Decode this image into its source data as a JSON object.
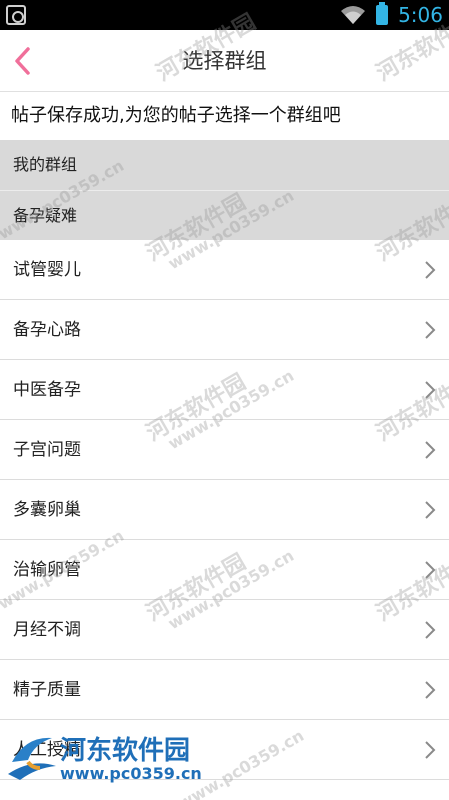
{
  "status_bar": {
    "time": "5:06",
    "icons": [
      "screenshot-icon",
      "wifi-icon",
      "battery-icon"
    ]
  },
  "header": {
    "title": "选择群组",
    "back_icon": "chevron-left-icon",
    "accent_color": "#f06f9a"
  },
  "notice": "帖子保存成功,为您的帖子选择一个群组吧",
  "sections": [
    {
      "label": "我的群组"
    },
    {
      "label": "备孕疑难"
    }
  ],
  "groups": [
    {
      "label": "试管婴儿"
    },
    {
      "label": "备孕心路"
    },
    {
      "label": "中医备孕"
    },
    {
      "label": "子宫问题"
    },
    {
      "label": "多囊卵巢"
    },
    {
      "label": "治输卵管"
    },
    {
      "label": "月经不调"
    },
    {
      "label": "精子质量"
    },
    {
      "label": "人工授精"
    }
  ],
  "watermark": {
    "text": "河东软件园",
    "url": "www.pc0359.cn"
  }
}
